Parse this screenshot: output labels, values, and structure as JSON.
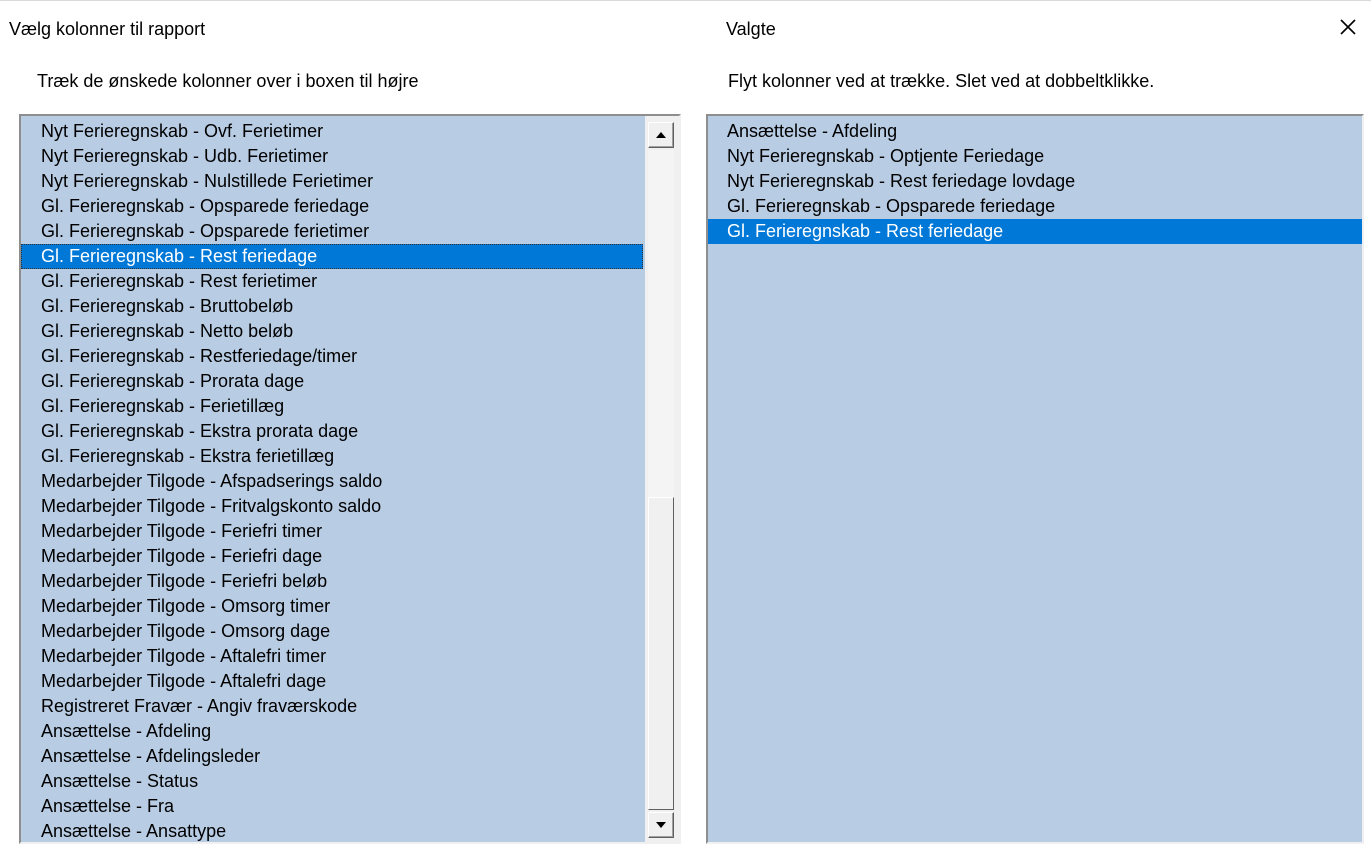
{
  "left_panel": {
    "title": "Vælg kolonner til rapport",
    "hint": "Træk de ønskede kolonner over i boxen til højre",
    "items": [
      "Nyt Ferieregnskab - Ovf. Ferietimer",
      "Nyt Ferieregnskab - Udb. Ferietimer",
      "Nyt Ferieregnskab - Nulstillede Ferietimer",
      "Gl. Ferieregnskab - Opsparede feriedage",
      "Gl. Ferieregnskab - Opsparede ferietimer",
      "Gl. Ferieregnskab - Rest feriedage",
      "Gl. Ferieregnskab - Rest ferietimer",
      "Gl. Ferieregnskab - Bruttobeløb",
      "Gl. Ferieregnskab - Netto beløb",
      "Gl. Ferieregnskab - Restferiedage/timer",
      "Gl. Ferieregnskab - Prorata dage",
      "Gl. Ferieregnskab - Ferietillæg",
      "Gl. Ferieregnskab - Ekstra prorata dage",
      "Gl. Ferieregnskab - Ekstra ferietillæg",
      "Medarbejder Tilgode - Afspadserings saldo",
      "Medarbejder Tilgode - Fritvalgskonto saldo",
      "Medarbejder Tilgode - Feriefri timer",
      "Medarbejder Tilgode - Feriefri dage",
      "Medarbejder Tilgode - Feriefri beløb",
      "Medarbejder Tilgode - Omsorg timer",
      "Medarbejder Tilgode - Omsorg dage",
      "Medarbejder Tilgode - Aftalefri timer",
      "Medarbejder Tilgode - Aftalefri dage",
      "Registreret Fravær - Angiv fraværskode",
      "Ansættelse - Afdeling",
      "Ansættelse - Afdelingsleder",
      "Ansættelse - Status",
      "Ansættelse - Fra",
      "Ansættelse - Ansattype"
    ],
    "selected_index": 5
  },
  "right_panel": {
    "title": "Valgte",
    "hint": "Flyt kolonner ved at trække. Slet ved at dobbeltklikke.",
    "items": [
      "Ansættelse - Afdeling",
      "Nyt Ferieregnskab - Optjente Feriedage",
      "Nyt Ferieregnskab - Rest feriedage lovdage",
      "Gl. Ferieregnskab - Opsparede feriedage",
      "Gl. Ferieregnskab - Rest feriedage"
    ],
    "selected_index": 4
  },
  "icons": {
    "close": "close-icon",
    "scroll_up": "arrow-up-icon",
    "scroll_down": "arrow-down-icon"
  },
  "colors": {
    "list_background": "#b8cce4",
    "selection": "#0078d7"
  }
}
